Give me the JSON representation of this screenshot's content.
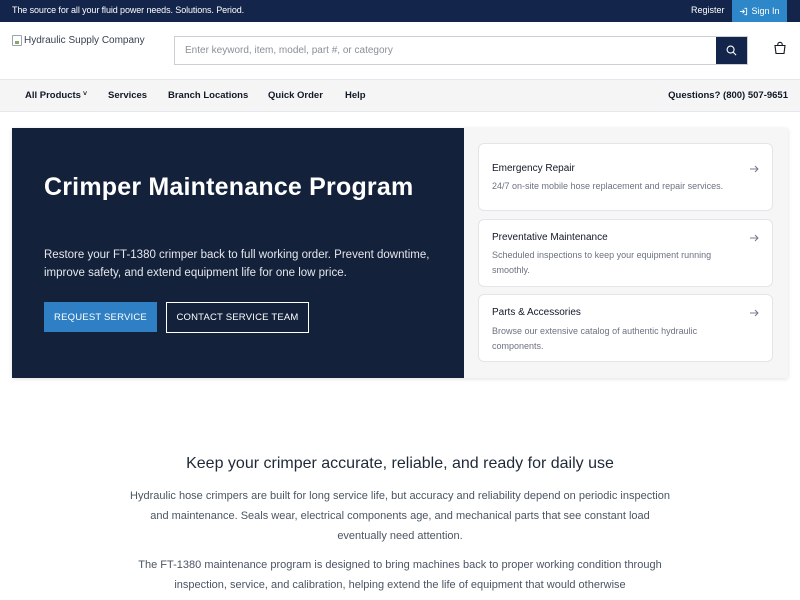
{
  "topbar": {
    "tagline": "The source for all your fluid power needs. Solutions. Period.",
    "register": "Register",
    "signin": "Sign In"
  },
  "header": {
    "logo_alt": "Hydraulic Supply Company",
    "search_placeholder": "Enter keyword, item, model, part #, or category"
  },
  "nav": {
    "items": [
      "All Products",
      "Services",
      "Branch Locations",
      "Quick Order",
      "Help"
    ],
    "all_products_caret": "˅",
    "phone": "Questions? (800) 507-9651"
  },
  "hero": {
    "title": "Crimper Maintenance Program",
    "description": "Restore your FT-1380 crimper back to full working order. Prevent downtime, improve safety, and extend equipment life for one low price.",
    "primary_button": "REQUEST SERVICE",
    "secondary_button": "CONTACT SERVICE TEAM"
  },
  "service_cards": [
    {
      "title": "Emergency Repair",
      "description": "24/7 on-site mobile hose replacement and repair services."
    },
    {
      "title": "Preventative Maintenance",
      "description": "Scheduled inspections to keep your equipment running smoothly."
    },
    {
      "title": "Parts & Accessories",
      "description": "Browse our extensive catalog of authentic hydraulic components."
    }
  ],
  "content": {
    "heading": "Keep your crimper accurate, reliable, and ready for daily use",
    "paragraph1": "Hydraulic hose crimpers are built for long service life, but accuracy and reliability depend on periodic inspection and maintenance. Seals wear, electrical components age, and mechanical parts that see constant load eventually need attention.",
    "paragraph2": "The FT-1380 maintenance program is designed to bring machines back to proper working condition through inspection, service, and calibration, helping extend the life of equipment that would otherwise"
  },
  "colors": {
    "navy": "#13254a",
    "hero_bg": "#13213b",
    "accent_blue": "#2f7fc4",
    "signin_blue": "#2d87c8"
  },
  "icons": {
    "signin": "sign-in-icon",
    "search": "search-icon",
    "cart": "shopping-bag-icon",
    "card_arrow": "arrow-right-icon"
  }
}
